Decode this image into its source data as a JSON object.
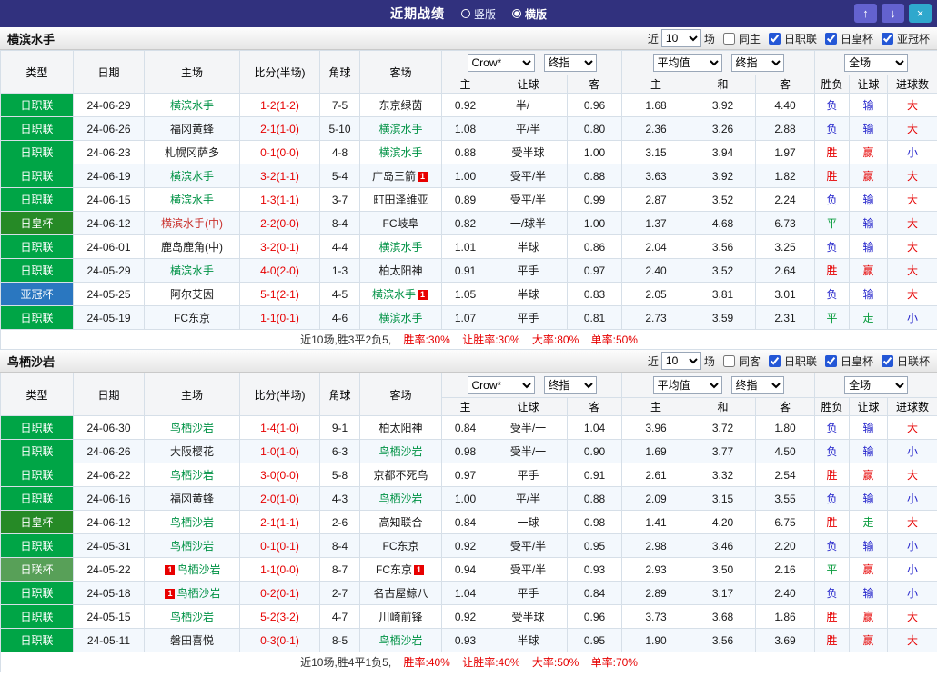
{
  "topbar": {
    "title": "近期战绩",
    "vertical_label": "竖版",
    "horizontal_label": "横版",
    "selected": "横版",
    "buttons": {
      "up": "↑",
      "down": "↓",
      "close": "×"
    }
  },
  "columns": {
    "type": "类型",
    "date": "日期",
    "home": "主场",
    "score": "比分(半场)",
    "corners": "角球",
    "away": "客场",
    "bookmaker_select": "Crow*",
    "final_select": "终指",
    "average_select": "平均值",
    "scope_select": "全场",
    "ah_home": "主",
    "ah_line": "让球",
    "ah_away": "客",
    "eu_home": "主",
    "eu_draw": "和",
    "eu_away": "客",
    "res_outcome": "胜负",
    "res_handicap": "让球",
    "res_goals": "进球数"
  },
  "league_colors": {
    "日职联": "#00a546",
    "日皇杯": "#268a26",
    "亚冠杯": "#2a77c0",
    "日联杯": "#58a058"
  },
  "team_colors": {
    "green": "#009245",
    "black": "#1a1a1a",
    "red": "#c9302c"
  },
  "result_colors": {
    "red": "#e60000",
    "blue": "#2323cb",
    "green": "#089b3c"
  },
  "sections": [
    {
      "team": "横滨水手",
      "controls": {
        "near": "近",
        "count": "10",
        "games": "场",
        "same": {
          "label": "同主",
          "checked": false
        },
        "filters": [
          {
            "label": "日职联",
            "checked": true
          },
          {
            "label": "日皇杯",
            "checked": true
          },
          {
            "label": "亚冠杯",
            "checked": true
          }
        ]
      },
      "rows": [
        {
          "league": "日职联",
          "date": "24-06-29",
          "home": {
            "name": "横滨水手",
            "color": "green",
            "cards": 0
          },
          "score": "1-2(1-2)",
          "corners": "7-5",
          "away": {
            "name": "东京绿茵",
            "color": "black",
            "cards": 0
          },
          "ah": [
            "0.92",
            "半/一",
            "0.96"
          ],
          "eu": [
            "1.68",
            "3.92",
            "4.40"
          ],
          "results": [
            [
              "负",
              "blue"
            ],
            [
              "输",
              "blue"
            ],
            [
              "大",
              "red"
            ]
          ]
        },
        {
          "league": "日职联",
          "date": "24-06-26",
          "home": {
            "name": "福冈黄蜂",
            "color": "black",
            "cards": 0
          },
          "score": "2-1(1-0)",
          "corners": "5-10",
          "away": {
            "name": "横滨水手",
            "color": "green",
            "cards": 0
          },
          "ah": [
            "1.08",
            "平/半",
            "0.80"
          ],
          "eu": [
            "2.36",
            "3.26",
            "2.88"
          ],
          "results": [
            [
              "负",
              "blue"
            ],
            [
              "输",
              "blue"
            ],
            [
              "大",
              "red"
            ]
          ]
        },
        {
          "league": "日职联",
          "date": "24-06-23",
          "home": {
            "name": "札幌冈萨多",
            "color": "black",
            "cards": 0
          },
          "score": "0-1(0-0)",
          "corners": "4-8",
          "away": {
            "name": "横滨水手",
            "color": "green",
            "cards": 0
          },
          "ah": [
            "0.88",
            "受半球",
            "1.00"
          ],
          "eu": [
            "3.15",
            "3.94",
            "1.97"
          ],
          "results": [
            [
              "胜",
              "red"
            ],
            [
              "赢",
              "red"
            ],
            [
              "小",
              "blue"
            ]
          ]
        },
        {
          "league": "日职联",
          "date": "24-06-19",
          "home": {
            "name": "横滨水手",
            "color": "green",
            "cards": 0
          },
          "score": "3-2(1-1)",
          "corners": "5-4",
          "away": {
            "name": "广岛三箭",
            "color": "black",
            "cards": 1,
            "cards_pos": "right"
          },
          "ah": [
            "1.00",
            "受平/半",
            "0.88"
          ],
          "eu": [
            "3.63",
            "3.92",
            "1.82"
          ],
          "results": [
            [
              "胜",
              "red"
            ],
            [
              "赢",
              "red"
            ],
            [
              "大",
              "red"
            ]
          ]
        },
        {
          "league": "日职联",
          "date": "24-06-15",
          "home": {
            "name": "横滨水手",
            "color": "green",
            "cards": 0
          },
          "score": "1-3(1-1)",
          "corners": "3-7",
          "away": {
            "name": "町田泽维亚",
            "color": "black",
            "cards": 0
          },
          "ah": [
            "0.89",
            "受平/半",
            "0.99"
          ],
          "eu": [
            "2.87",
            "3.52",
            "2.24"
          ],
          "results": [
            [
              "负",
              "blue"
            ],
            [
              "输",
              "blue"
            ],
            [
              "大",
              "red"
            ]
          ]
        },
        {
          "league": "日皇杯",
          "date": "24-06-12",
          "home": {
            "name": "横滨水手(中)",
            "color": "red",
            "cards": 0
          },
          "score": "2-2(0-0)",
          "corners": "8-4",
          "away": {
            "name": "FC岐阜",
            "color": "black",
            "cards": 0
          },
          "ah": [
            "0.82",
            "一/球半",
            "1.00"
          ],
          "eu": [
            "1.37",
            "4.68",
            "6.73"
          ],
          "results": [
            [
              "平",
              "green"
            ],
            [
              "输",
              "blue"
            ],
            [
              "大",
              "red"
            ]
          ]
        },
        {
          "league": "日职联",
          "date": "24-06-01",
          "home": {
            "name": "鹿岛鹿角(中)",
            "color": "black",
            "cards": 0
          },
          "score": "3-2(0-1)",
          "corners": "4-4",
          "away": {
            "name": "横滨水手",
            "color": "green",
            "cards": 0
          },
          "ah": [
            "1.01",
            "半球",
            "0.86"
          ],
          "eu": [
            "2.04",
            "3.56",
            "3.25"
          ],
          "results": [
            [
              "负",
              "blue"
            ],
            [
              "输",
              "blue"
            ],
            [
              "大",
              "red"
            ]
          ]
        },
        {
          "league": "日职联",
          "date": "24-05-29",
          "home": {
            "name": "横滨水手",
            "color": "green",
            "cards": 0
          },
          "score": "4-0(2-0)",
          "corners": "1-3",
          "away": {
            "name": "柏太阳神",
            "color": "black",
            "cards": 0
          },
          "ah": [
            "0.91",
            "平手",
            "0.97"
          ],
          "eu": [
            "2.40",
            "3.52",
            "2.64"
          ],
          "results": [
            [
              "胜",
              "red"
            ],
            [
              "赢",
              "red"
            ],
            [
              "大",
              "red"
            ]
          ]
        },
        {
          "league": "亚冠杯",
          "date": "24-05-25",
          "home": {
            "name": "阿尔艾因",
            "color": "black",
            "cards": 0
          },
          "score": "5-1(2-1)",
          "corners": "4-5",
          "away": {
            "name": "横滨水手",
            "color": "green",
            "cards": 1,
            "cards_pos": "right"
          },
          "ah": [
            "1.05",
            "半球",
            "0.83"
          ],
          "eu": [
            "2.05",
            "3.81",
            "3.01"
          ],
          "results": [
            [
              "负",
              "blue"
            ],
            [
              "输",
              "blue"
            ],
            [
              "大",
              "red"
            ]
          ]
        },
        {
          "league": "日职联",
          "date": "24-05-19",
          "home": {
            "name": "FC东京",
            "color": "black",
            "cards": 0
          },
          "score": "1-1(0-1)",
          "corners": "4-6",
          "away": {
            "name": "横滨水手",
            "color": "green",
            "cards": 0
          },
          "ah": [
            "1.07",
            "平手",
            "0.81"
          ],
          "eu": [
            "2.73",
            "3.59",
            "2.31"
          ],
          "results": [
            [
              "平",
              "green"
            ],
            [
              "走",
              "green"
            ],
            [
              "小",
              "blue"
            ]
          ]
        }
      ],
      "summary": {
        "record": "近10场,胜3平2负5,",
        "stats": [
          "胜率:30%",
          "让胜率:30%",
          "大率:80%",
          "单率:50%"
        ]
      }
    },
    {
      "team": "鸟栖沙岩",
      "controls": {
        "near": "近",
        "count": "10",
        "games": "场",
        "same": {
          "label": "同客",
          "checked": false
        },
        "filters": [
          {
            "label": "日职联",
            "checked": true
          },
          {
            "label": "日皇杯",
            "checked": true
          },
          {
            "label": "日联杯",
            "checked": true
          }
        ]
      },
      "rows": [
        {
          "league": "日职联",
          "date": "24-06-30",
          "home": {
            "name": "鸟栖沙岩",
            "color": "green",
            "cards": 0
          },
          "score": "1-4(1-0)",
          "corners": "9-1",
          "away": {
            "name": "柏太阳神",
            "color": "black",
            "cards": 0
          },
          "ah": [
            "0.84",
            "受半/一",
            "1.04"
          ],
          "eu": [
            "3.96",
            "3.72",
            "1.80"
          ],
          "results": [
            [
              "负",
              "blue"
            ],
            [
              "输",
              "blue"
            ],
            [
              "大",
              "red"
            ]
          ]
        },
        {
          "league": "日职联",
          "date": "24-06-26",
          "home": {
            "name": "大阪樱花",
            "color": "black",
            "cards": 0
          },
          "score": "1-0(1-0)",
          "corners": "6-3",
          "away": {
            "name": "鸟栖沙岩",
            "color": "green",
            "cards": 0
          },
          "ah": [
            "0.98",
            "受半/一",
            "0.90"
          ],
          "eu": [
            "1.69",
            "3.77",
            "4.50"
          ],
          "results": [
            [
              "负",
              "blue"
            ],
            [
              "输",
              "blue"
            ],
            [
              "小",
              "blue"
            ]
          ]
        },
        {
          "league": "日职联",
          "date": "24-06-22",
          "home": {
            "name": "鸟栖沙岩",
            "color": "green",
            "cards": 0
          },
          "score": "3-0(0-0)",
          "corners": "5-8",
          "away": {
            "name": "京都不死鸟",
            "color": "black",
            "cards": 0
          },
          "ah": [
            "0.97",
            "平手",
            "0.91"
          ],
          "eu": [
            "2.61",
            "3.32",
            "2.54"
          ],
          "results": [
            [
              "胜",
              "red"
            ],
            [
              "赢",
              "red"
            ],
            [
              "大",
              "red"
            ]
          ]
        },
        {
          "league": "日职联",
          "date": "24-06-16",
          "home": {
            "name": "福冈黄蜂",
            "color": "black",
            "cards": 0
          },
          "score": "2-0(1-0)",
          "corners": "4-3",
          "away": {
            "name": "鸟栖沙岩",
            "color": "green",
            "cards": 0
          },
          "ah": [
            "1.00",
            "平/半",
            "0.88"
          ],
          "eu": [
            "2.09",
            "3.15",
            "3.55"
          ],
          "results": [
            [
              "负",
              "blue"
            ],
            [
              "输",
              "blue"
            ],
            [
              "小",
              "blue"
            ]
          ]
        },
        {
          "league": "日皇杯",
          "date": "24-06-12",
          "home": {
            "name": "鸟栖沙岩",
            "color": "green",
            "cards": 0
          },
          "score": "2-1(1-1)",
          "corners": "2-6",
          "away": {
            "name": "高知联合",
            "color": "black",
            "cards": 0
          },
          "ah": [
            "0.84",
            "一球",
            "0.98"
          ],
          "eu": [
            "1.41",
            "4.20",
            "6.75"
          ],
          "results": [
            [
              "胜",
              "red"
            ],
            [
              "走",
              "green"
            ],
            [
              "大",
              "red"
            ]
          ]
        },
        {
          "league": "日职联",
          "date": "24-05-31",
          "home": {
            "name": "鸟栖沙岩",
            "color": "green",
            "cards": 0
          },
          "score": "0-1(0-1)",
          "corners": "8-4",
          "away": {
            "name": "FC东京",
            "color": "black",
            "cards": 0
          },
          "ah": [
            "0.92",
            "受平/半",
            "0.95"
          ],
          "eu": [
            "2.98",
            "3.46",
            "2.20"
          ],
          "results": [
            [
              "负",
              "blue"
            ],
            [
              "输",
              "blue"
            ],
            [
              "小",
              "blue"
            ]
          ]
        },
        {
          "league": "日联杯",
          "date": "24-05-22",
          "home": {
            "name": "鸟栖沙岩",
            "color": "green",
            "cards": 1,
            "cards_pos": "left"
          },
          "score": "1-1(0-0)",
          "corners": "8-7",
          "away": {
            "name": "FC东京",
            "color": "black",
            "cards": 1,
            "cards_pos": "right"
          },
          "ah": [
            "0.94",
            "受平/半",
            "0.93"
          ],
          "eu": [
            "2.93",
            "3.50",
            "2.16"
          ],
          "results": [
            [
              "平",
              "green"
            ],
            [
              "赢",
              "red"
            ],
            [
              "小",
              "blue"
            ]
          ]
        },
        {
          "league": "日职联",
          "date": "24-05-18",
          "home": {
            "name": "鸟栖沙岩",
            "color": "green",
            "cards": 1,
            "cards_pos": "left"
          },
          "score": "0-2(0-1)",
          "corners": "2-7",
          "away": {
            "name": "名古屋鲸八",
            "color": "black",
            "cards": 0
          },
          "ah": [
            "1.04",
            "平手",
            "0.84"
          ],
          "eu": [
            "2.89",
            "3.17",
            "2.40"
          ],
          "results": [
            [
              "负",
              "blue"
            ],
            [
              "输",
              "blue"
            ],
            [
              "小",
              "blue"
            ]
          ]
        },
        {
          "league": "日职联",
          "date": "24-05-15",
          "home": {
            "name": "鸟栖沙岩",
            "color": "green",
            "cards": 0
          },
          "score": "5-2(3-2)",
          "corners": "4-7",
          "away": {
            "name": "川崎前锋",
            "color": "black",
            "cards": 0
          },
          "ah": [
            "0.92",
            "受半球",
            "0.96"
          ],
          "eu": [
            "3.73",
            "3.68",
            "1.86"
          ],
          "results": [
            [
              "胜",
              "red"
            ],
            [
              "赢",
              "red"
            ],
            [
              "大",
              "red"
            ]
          ]
        },
        {
          "league": "日职联",
          "date": "24-05-11",
          "home": {
            "name": "磐田喜悦",
            "color": "black",
            "cards": 0
          },
          "score": "0-3(0-1)",
          "corners": "8-5",
          "away": {
            "name": "鸟栖沙岩",
            "color": "green",
            "cards": 0
          },
          "ah": [
            "0.93",
            "半球",
            "0.95"
          ],
          "eu": [
            "1.90",
            "3.56",
            "3.69"
          ],
          "results": [
            [
              "胜",
              "red"
            ],
            [
              "赢",
              "red"
            ],
            [
              "大",
              "red"
            ]
          ]
        }
      ],
      "summary": {
        "record": "近10场,胜4平1负5,",
        "stats": [
          "胜率:40%",
          "让胜率:40%",
          "大率:50%",
          "单率:70%"
        ]
      }
    }
  ]
}
